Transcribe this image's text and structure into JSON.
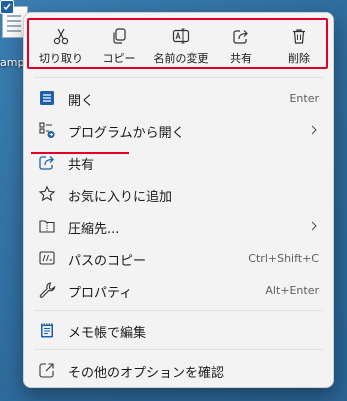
{
  "colors": {
    "accent": "#0067c0",
    "annotation": "#e0002a",
    "menu_bg": "#f3f3f3"
  },
  "desktop": {
    "file_label": "ampl"
  },
  "quick_actions": [
    {
      "label": "切り取り",
      "icon": "scissors-icon"
    },
    {
      "label": "コピー",
      "icon": "copy-icon"
    },
    {
      "label": "名前の変更",
      "icon": "rename-icon"
    },
    {
      "label": "共有",
      "icon": "share-icon"
    },
    {
      "label": "削除",
      "icon": "trash-icon"
    }
  ],
  "items": [
    {
      "label": "開く",
      "shortcut": "Enter",
      "icon": "open-icon"
    },
    {
      "label": "プログラムから開く",
      "shortcut": "",
      "icon": "open-with-icon",
      "submenu": true
    },
    {
      "label": "共有",
      "shortcut": "",
      "icon": "share-icon"
    },
    {
      "label": "お気に入りに追加",
      "shortcut": "",
      "icon": "star-icon"
    },
    {
      "label": "圧縮先...",
      "shortcut": "",
      "icon": "zip-folder-icon",
      "submenu": true
    },
    {
      "label": "パスのコピー",
      "shortcut": "Ctrl+Shift+C",
      "icon": "copy-path-icon"
    },
    {
      "label": "プロパティ",
      "shortcut": "Alt+Enter",
      "icon": "wrench-icon"
    },
    {
      "label": "メモ帳で編集",
      "shortcut": "",
      "icon": "notepad-icon"
    },
    {
      "label": "その他のオプションを確認",
      "shortcut": "",
      "icon": "more-options-icon"
    }
  ]
}
